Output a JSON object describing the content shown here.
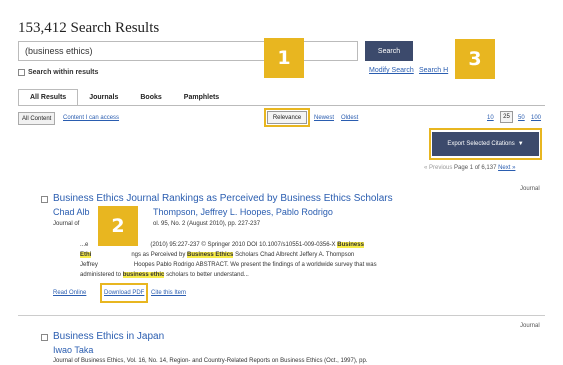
{
  "header": {
    "results_count": "153,412 Search Results"
  },
  "search": {
    "value": "(business ethics)",
    "button_label": "Search",
    "within_label": "Search within results",
    "modify_label": "Modify Search",
    "help_label": "Search H"
  },
  "tabs": [
    "All Results",
    "Journals",
    "Books",
    "Pamphlets"
  ],
  "filters": {
    "active": "All Content",
    "link": "Content I can access"
  },
  "sort": {
    "relevance": "Relevance",
    "newest": "Newest",
    "oldest": "Oldest"
  },
  "per_page": {
    "options": [
      "10",
      "25",
      "50",
      "100"
    ],
    "selected": "25"
  },
  "export": {
    "label": "Export Selected Citations",
    "arrow": "▼"
  },
  "pager": {
    "previous": "« Previous",
    "page_text": "Page 1 of 6,137",
    "next": "Next »"
  },
  "results": [
    {
      "title": "Business Ethics Journal Rankings as Perceived by Business Ethics Scholars",
      "authors_left": "Chad Alb",
      "authors_right": "Thompson, Jeffrey L. Hoopes, Pablo Rodrigo",
      "journal_left": "Journal of",
      "journal_right": "ol. 95, No. 2 (August 2010), pp. 227-237",
      "type": "Journal",
      "snippet": [
        {
          "before": "...e",
          "after": "(2010) 95:227-237 © Springer 2010 DOI 10.1007/s10551-009-0356-X",
          "hl": "Business"
        },
        {
          "hl": "Ethi",
          "mid": "ngs as Perceived by",
          "hl2": "Business Ethics",
          "after": "Scholars Chad Albrecht Jeffery A. Thompson"
        },
        {
          "before": "Jeffrey",
          "mid": "Hoopes Pablo Rodrigo ABSTRACT. We present the findings of a worldwide survey that was"
        },
        {
          "before": "administered to",
          "hl": "business ethic",
          "after": "scholars to better understand..."
        }
      ],
      "actions": {
        "read_online": "Read Online",
        "download_pdf": "Download PDF",
        "cite": "Cite this Item"
      }
    },
    {
      "title": "Business Ethics in Japan",
      "authors": "Iwao Taka",
      "journal": "Journal of Business Ethics, Vol. 16, No. 14, Region- and Country-Related Reports on Business Ethics (Oct., 1997), pp.",
      "type": "Journal"
    }
  ],
  "callouts": [
    "1",
    "2",
    "3"
  ],
  "colors": {
    "accent": "#e8b620",
    "button": "#3c4a6c",
    "link": "#2a5db0",
    "highlight": "#f7ec4b"
  }
}
